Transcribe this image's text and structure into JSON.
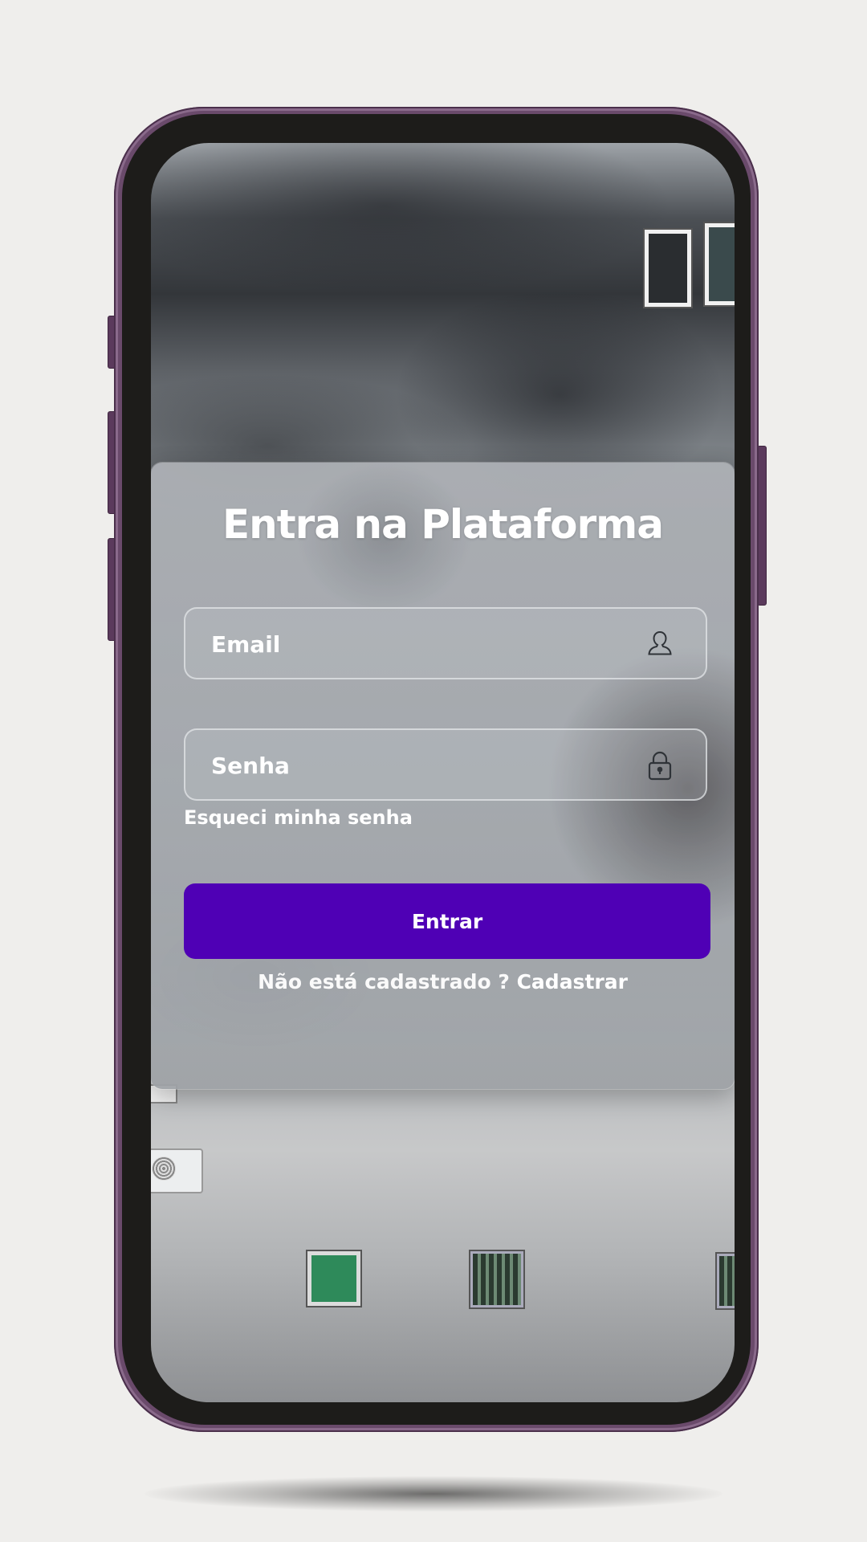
{
  "login": {
    "title": "Entra na Plataforma",
    "email_placeholder": "Email",
    "password_placeholder": "Senha",
    "forgot_password": "Esqueci minha senha",
    "submit_label": "Entrar",
    "signup_prompt": "Não está cadastrado ? ",
    "signup_link": "Cadastrar"
  },
  "icons": {
    "email_field": "user-icon",
    "password_field": "lock-icon"
  },
  "colors": {
    "primary_button": "#4f00b5",
    "device_frame": "#6a4a6b",
    "text": "#ffffff"
  }
}
